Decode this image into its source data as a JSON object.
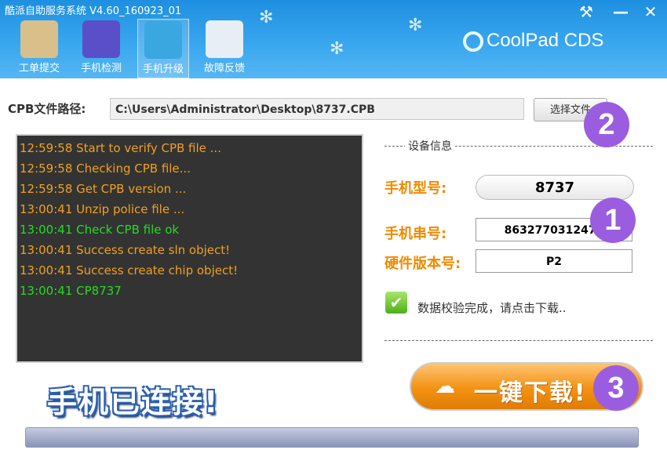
{
  "window": {
    "title": "酷派自助服务系统   V4.60_160923_01",
    "brand": "CoolPad CDS",
    "controls": [
      "⚒",
      "—",
      "✕"
    ]
  },
  "toolbar": [
    {
      "label": "工单提交",
      "icon": "chart-board-icon",
      "color": "#d9c08a"
    },
    {
      "label": "手机检测",
      "icon": "tools-icon",
      "color": "#5a4fc8"
    },
    {
      "label": "手机升级",
      "icon": "upgrade-phone-icon",
      "color": "#3aa7e0",
      "active": true
    },
    {
      "label": "故障反馈",
      "icon": "envelope-icon",
      "color": "#e8eef5"
    }
  ],
  "path": {
    "label": "CPB文件路径:",
    "value": "C:\\Users\\Administrator\\Desktop\\8737.CPB",
    "choose_button": "选择文件"
  },
  "log": [
    {
      "text": "12:59:58 Start to verify CPB file ...",
      "color": "#f0a020"
    },
    {
      "text": "12:59:58 Checking CPB file...",
      "color": "#f0a020"
    },
    {
      "text": "12:59:58 Get CPB version ...",
      "color": "#f0a020"
    },
    {
      "text": "13:00:41 Unzip police file ...",
      "color": "#f0a020"
    },
    {
      "text": "13:00:41 Check CPB file ok",
      "color": "#22dd22"
    },
    {
      "text": "13:00:41 Success create sln object!",
      "color": "#f0a020"
    },
    {
      "text": "13:00:41 Success create chip object!",
      "color": "#f0a020"
    },
    {
      "text": "13:00:41 CP8737",
      "color": "#22dd22"
    }
  ],
  "device": {
    "section_title": "设备信息",
    "model_label": "手机型号:",
    "model_value": "8737",
    "serial_label": "手机串号:",
    "serial_value": "8632770312471",
    "hw_label": "硬件版本号:",
    "hw_value": "P2",
    "verify_text": "数据校验完成，请点击下载.."
  },
  "download_button": "一键下载!",
  "connected_text": "手机已连接!",
  "badges": [
    "1",
    "2",
    "3"
  ],
  "progress": 0
}
